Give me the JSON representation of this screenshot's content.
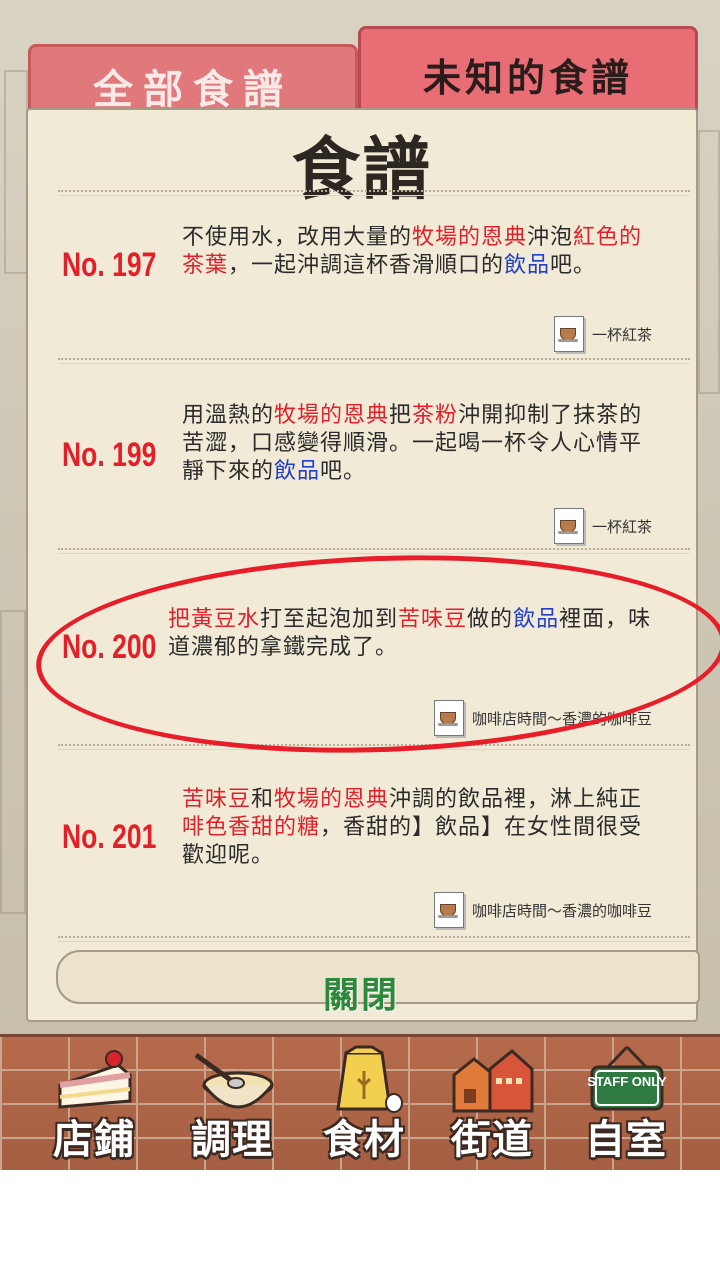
{
  "tabs": {
    "all_recipes": "全部食譜",
    "unknown_recipes": "未知的食譜"
  },
  "paper_title": "食譜",
  "recipes": [
    {
      "number": "No. 197",
      "desc_parts": [
        {
          "t": "不使用水，改用大量的",
          "c": ""
        },
        {
          "t": "牧場的恩典",
          "c": "red"
        },
        {
          "t": "沖泡",
          "c": ""
        },
        {
          "t": "紅色的茶葉",
          "c": "red"
        },
        {
          "t": "，一起沖調這杯香滑順口的",
          "c": ""
        },
        {
          "t": "飲品",
          "c": "blue"
        },
        {
          "t": "吧。",
          "c": ""
        }
      ],
      "source": "一杯紅茶"
    },
    {
      "number": "No. 199",
      "desc_parts": [
        {
          "t": "用溫熱的",
          "c": ""
        },
        {
          "t": "牧場的恩典",
          "c": "red"
        },
        {
          "t": "把",
          "c": ""
        },
        {
          "t": "茶粉",
          "c": "red"
        },
        {
          "t": "沖開抑制了抹茶的苦澀，口感變得順滑。一起喝一杯令人心情平靜下來的",
          "c": ""
        },
        {
          "t": "飲品",
          "c": "blue"
        },
        {
          "t": "吧。",
          "c": ""
        }
      ],
      "source": "一杯紅茶"
    },
    {
      "number": "No. 200",
      "desc_parts": [
        {
          "t": "把黃豆水",
          "c": "red"
        },
        {
          "t": "打至起泡加到",
          "c": ""
        },
        {
          "t": "苦味豆",
          "c": "red"
        },
        {
          "t": "做的",
          "c": ""
        },
        {
          "t": "飲品",
          "c": "blue"
        },
        {
          "t": "裡面，味道濃郁的拿鐵完成了。",
          "c": ""
        }
      ],
      "source": "咖啡店時間～香濃的咖啡豆"
    },
    {
      "number": "No. 201",
      "desc_parts": [
        {
          "t": "苦味豆",
          "c": "red"
        },
        {
          "t": "和",
          "c": ""
        },
        {
          "t": "牧場的恩典",
          "c": "red"
        },
        {
          "t": "沖調的飲品裡，淋上純正",
          "c": ""
        },
        {
          "t": "啡色香甜的糖",
          "c": "red"
        },
        {
          "t": "，香甜的】飲品】在女性間很受歡迎呢。",
          "c": ""
        }
      ],
      "source": "咖啡店時間～香濃的咖啡豆"
    }
  ],
  "close_label": "關閉",
  "nav": [
    {
      "label": "店鋪",
      "icon": "cake-icon"
    },
    {
      "label": "調理",
      "icon": "mixing-bowl-icon"
    },
    {
      "label": "食材",
      "icon": "flour-bag-icon"
    },
    {
      "label": "街道",
      "icon": "street-houses-icon"
    },
    {
      "label": "自室",
      "icon": "staff-only-sign-icon"
    }
  ],
  "nav_sign_text": "STAFF ONLY",
  "colors": {
    "highlight_red": "#e3202a",
    "highlight_blue": "#2240c8",
    "tab_pink": "#e96d75",
    "close_green": "#2a8a3a"
  }
}
